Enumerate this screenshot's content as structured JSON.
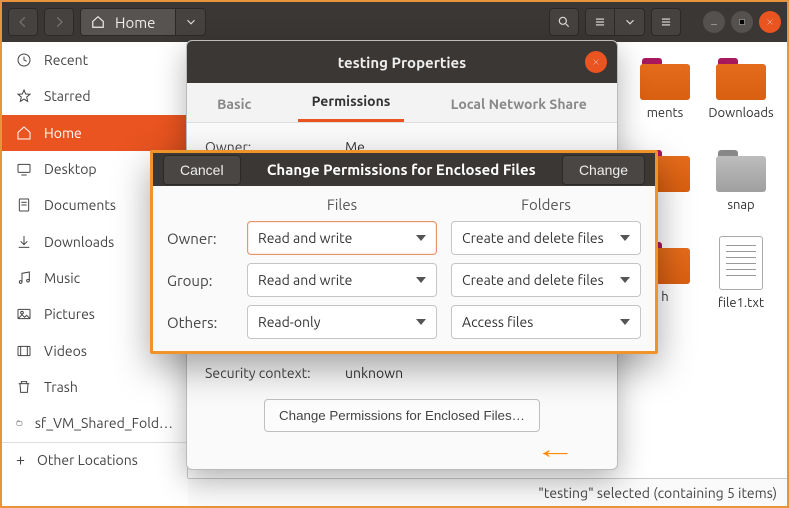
{
  "header": {
    "location_label": "Home"
  },
  "sidebar": {
    "items": [
      {
        "label": "Recent"
      },
      {
        "label": "Starred"
      },
      {
        "label": "Home"
      },
      {
        "label": "Desktop"
      },
      {
        "label": "Documents"
      },
      {
        "label": "Downloads"
      },
      {
        "label": "Music"
      },
      {
        "label": "Pictures"
      },
      {
        "label": "Videos"
      },
      {
        "label": "Trash"
      },
      {
        "label": "sf_VM_Shared_Fold…"
      }
    ],
    "other_locations": "Other Locations"
  },
  "grid": {
    "documents": "ments",
    "downloads": "Downloads",
    "snap": "snap",
    "h": "h",
    "file1": "file1.txt"
  },
  "statusbar": {
    "text": "\"testing\" selected  (containing 5 items)"
  },
  "properties": {
    "title": "testing Properties",
    "tabs": {
      "basic": "Basic",
      "permissions": "Permissions",
      "lns": "Local Network Share"
    },
    "owner_label": "Owner:",
    "owner_value": "Me",
    "security_label": "Security context:",
    "security_value": "unknown",
    "change_button": "Change Permissions for Enclosed Files…"
  },
  "modal": {
    "title": "Change Permissions for Enclosed Files",
    "cancel": "Cancel",
    "change": "Change",
    "col_files": "Files",
    "col_folders": "Folders",
    "rows": {
      "owner": {
        "label": "Owner:",
        "files": "Read and write",
        "folders": "Create and delete files"
      },
      "group": {
        "label": "Group:",
        "files": "Read and write",
        "folders": "Create and delete files"
      },
      "others": {
        "label": "Others:",
        "files": "Read-only",
        "folders": "Access files"
      }
    }
  }
}
